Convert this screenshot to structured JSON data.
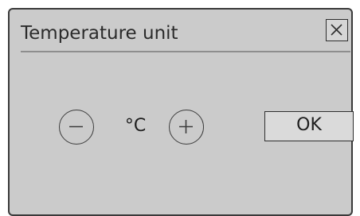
{
  "dialog": {
    "title": "Temperature unit",
    "close_icon": "close-icon",
    "unit": "°C",
    "decrease_icon": "minus-icon",
    "increase_icon": "plus-icon",
    "ok_label": "OK"
  },
  "colors": {
    "background": "#cbcbcb",
    "border": "#3a3a3a",
    "divider": "#8e8e8e",
    "text": "#1e1e1e"
  }
}
